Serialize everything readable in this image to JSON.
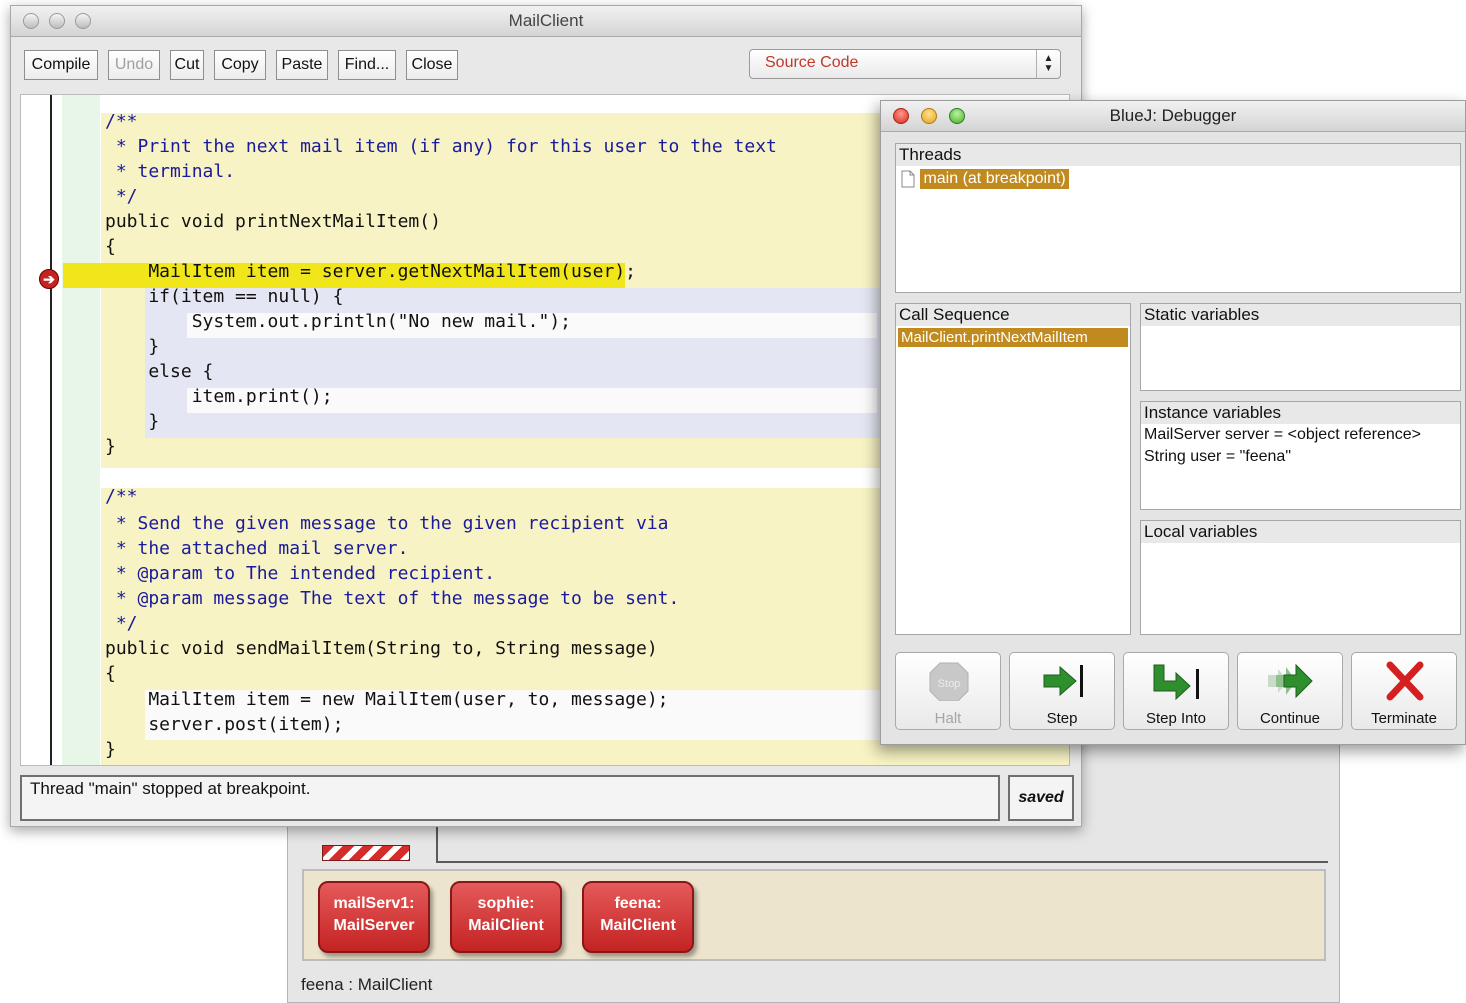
{
  "editor": {
    "title": "MailClient",
    "toolbar": {
      "compile": "Compile",
      "undo": "Undo",
      "cut": "Cut",
      "copy": "Copy",
      "paste": "Paste",
      "find": "Find...",
      "close": "Close"
    },
    "view_select": "Source Code",
    "code_lines": [
      "/**",
      " * Print the next mail item (if any) for this user to the text",
      " * terminal.",
      " */",
      "public void printNextMailItem()",
      "{",
      "    MailItem item = server.getNextMailItem(user);",
      "    if(item == null) {",
      "        System.out.println(\"No new mail.\");",
      "    }",
      "    else {",
      "        item.print();",
      "    }",
      "}",
      "/**",
      " * Send the given message to the given recipient via",
      " * the attached mail server.",
      " * @param to The intended recipient.",
      " * @param message The text of the message to be sent.",
      " */",
      "public void sendMailItem(String to, String message)",
      "{",
      "    MailItem item = new MailItem(user, to, message);",
      "    server.post(item);",
      "}"
    ],
    "status_message": "Thread \"main\" stopped at breakpoint.",
    "saved_label": "saved"
  },
  "debugger": {
    "title": "BlueJ:  Debugger",
    "threads_heading": "Threads",
    "thread_selected": "main (at breakpoint)",
    "call_sequence_heading": "Call Sequence",
    "call_selected": "MailClient.printNextMailItem",
    "static_heading": "Static variables",
    "instance_heading": "Instance variables",
    "instance_vars": [
      "MailServer server = <object reference>",
      "String user = \"feena\""
    ],
    "local_heading": "Local variables",
    "buttons": {
      "halt": "Halt",
      "halt_icon_text": "Stop",
      "step": "Step",
      "step_into": "Step Into",
      "continue": "Continue",
      "terminate": "Terminate"
    }
  },
  "bench": {
    "objects": [
      {
        "name": "mailServ1:",
        "type": "MailServer"
      },
      {
        "name": "sophie:",
        "type": "MailClient"
      },
      {
        "name": "feena:",
        "type": "MailClient"
      }
    ],
    "status": "feena : MailClient"
  },
  "colors": {
    "breakpoint_line": "#f1e61a",
    "method_scope": "#f7f3c4",
    "block_scope": "#e4e6f3",
    "selection": "#c08a1e",
    "object_red": "#d43030"
  }
}
